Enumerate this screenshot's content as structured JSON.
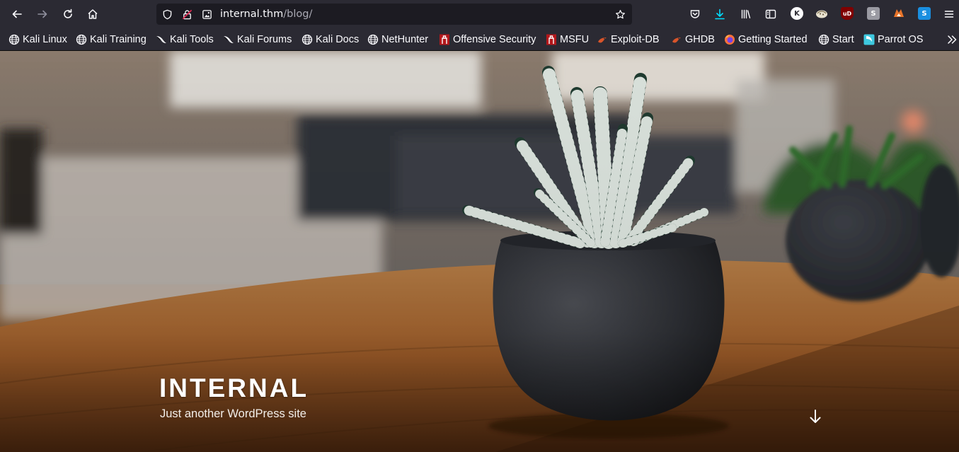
{
  "browser": {
    "url": {
      "host": "internal.thm",
      "path": "/blog/"
    },
    "icons": {
      "back": "arrow-left-icon",
      "forward": "arrow-right-icon",
      "reload": "reload-icon",
      "home": "home-icon",
      "shield": "tracking-protection-shield-icon",
      "insecure": "insecure-connection-lock-icon",
      "page": "page-image-icon",
      "bookmark_star": "star-icon",
      "pocket": "pocket-icon",
      "downloads": "download-icon",
      "library": "library-icon",
      "sidebar": "sidebar-icon",
      "menu": "hamburger-menu-icon",
      "overflow": "chevron-double-right-icon"
    }
  },
  "bookmarks": [
    {
      "label": "Kali Linux",
      "icon": "globe-icon"
    },
    {
      "label": "Kali Training",
      "icon": "globe-icon"
    },
    {
      "label": "Kali Tools",
      "icon": "kali-dragon-icon"
    },
    {
      "label": "Kali Forums",
      "icon": "kali-dragon-icon"
    },
    {
      "label": "Kali Docs",
      "icon": "globe-icon"
    },
    {
      "label": "NetHunter",
      "icon": "globe-icon"
    },
    {
      "label": "Offensive Security",
      "icon": "offsec-icon"
    },
    {
      "label": "MSFU",
      "icon": "offsec-icon"
    },
    {
      "label": "Exploit-DB",
      "icon": "exploit-db-icon"
    },
    {
      "label": "GHDB",
      "icon": "exploit-db-icon"
    },
    {
      "label": "Getting Started",
      "icon": "firefox-icon"
    },
    {
      "label": "Start",
      "icon": "globe-icon"
    },
    {
      "label": "Parrot OS",
      "icon": "parrot-icon"
    }
  ],
  "site": {
    "title": "INTERNAL",
    "tagline": "Just another WordPress site",
    "scroll_icon": "arrow-down-icon"
  },
  "colors": {
    "toolbar_bg": "#2b2a33",
    "urlbar_bg": "#1c1b22",
    "download_accent": "#00ddff",
    "offsec_red": "#b3171b",
    "exploitdb_orange": "#d8542a"
  }
}
